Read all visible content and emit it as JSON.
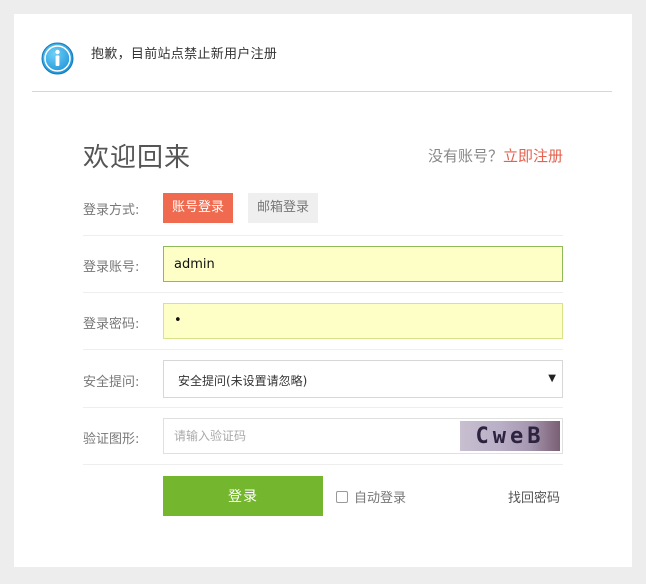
{
  "notice": {
    "text": "抱歉，目前站点禁止新用户注册",
    "icon": "info-icon"
  },
  "header": {
    "title": "欢迎回来",
    "no_account": "没有账号？",
    "register": "立即注册"
  },
  "login_method": {
    "label": "登录方式:",
    "tabs": [
      "账号登录",
      "邮箱登录"
    ],
    "active": 0
  },
  "account": {
    "label": "登录账号:",
    "value": "admin"
  },
  "password": {
    "label": "登录密码:",
    "value": "•"
  },
  "security": {
    "label": "安全提问:",
    "selected": "安全提问(未设置请忽略)",
    "arrow": "▼"
  },
  "captcha": {
    "label": "验证图形:",
    "placeholder": "请输入验证码",
    "image_text": "CweB"
  },
  "actions": {
    "login": "登录",
    "auto_login": "自动登录",
    "forgot": "找回密码"
  },
  "colors": {
    "accent": "#ef6a4f",
    "register_link": "#e4624f",
    "login_button": "#74b72e",
    "input_highlight": "#fdffc6"
  }
}
